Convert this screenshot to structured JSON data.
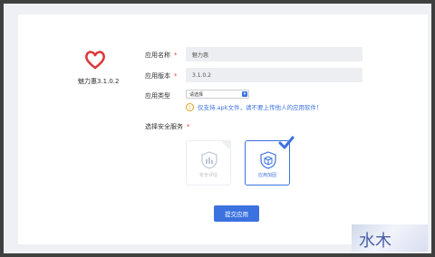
{
  "app": {
    "name": "魅力惠3.1.0.2",
    "logo_icon": "heart-icon",
    "logo_color": "#d93b3b"
  },
  "form": {
    "app_name_label": "应用名称",
    "app_name_value": "魅力惠",
    "version_label": "应用版本",
    "version_value": "3.1.0.2",
    "type_label": "应用类型",
    "type_select_value": "请选择",
    "required_mark": "*",
    "notice": "仅支持.apk文件，请不要上传他人的应用软件！",
    "services_label": "选择安全服务",
    "services": [
      {
        "label": "安全评估",
        "icon": "chart-shield-icon",
        "selected": false,
        "disabled": true
      },
      {
        "label": "应用加固",
        "icon": "box-shield-icon",
        "selected": true,
        "disabled": false
      }
    ],
    "submit_label": "提交应用"
  },
  "watermark": {
    "text": "水木"
  },
  "colors": {
    "accent": "#3b72e0",
    "required": "#e23b3b",
    "warning": "#e0a020"
  }
}
